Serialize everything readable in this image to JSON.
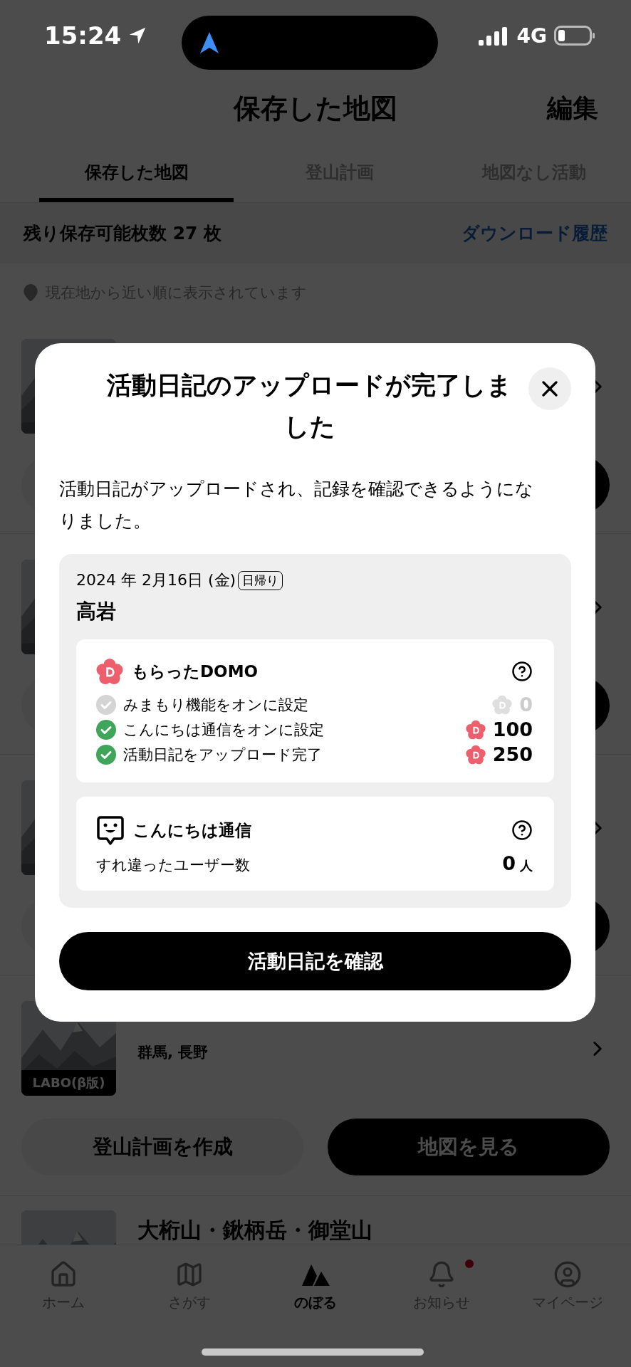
{
  "status_bar": {
    "time": "15:24",
    "network": "4G"
  },
  "header": {
    "title": "保存した地図",
    "edit": "編集"
  },
  "tabs": [
    {
      "label": "保存した地図",
      "selected": true
    },
    {
      "label": "登山計画",
      "selected": false
    },
    {
      "label": "地図なし活動",
      "selected": false
    }
  ],
  "quota": {
    "text": "残り保存可能枚数 27 枚",
    "link": "ダウンロード履歴"
  },
  "sort_note": "現在地から近い順に表示されています",
  "map_cards": [
    {
      "kind": "covered"
    },
    {
      "kind": "covered"
    },
    {
      "kind": "covered"
    },
    {
      "kind": "full",
      "region": "群馬, 長野",
      "badge": "LABO(β版)",
      "plan_button": "登山計画を作成",
      "map_button": "地図を見る"
    },
    {
      "kind": "partial",
      "title": "大桁山・鍬柄岳・御堂山"
    }
  ],
  "dialog": {
    "title": "活動日記のアップロードが完了しました",
    "message": "活動日記がアップロードされ、記録を確認できるようになりました。",
    "date": "2024 年 2月16日 (金)",
    "trip_type": "日帰り",
    "mountain": "高岩",
    "domo": {
      "title": "もらったDOMO",
      "rows": [
        {
          "label": "みまもり機能をオンに設定",
          "points": "0",
          "achieved": false
        },
        {
          "label": "こんにちは通信をオンに設定",
          "points": "100",
          "achieved": true
        },
        {
          "label": "活動日記をアップロード完了",
          "points": "250",
          "achieved": true
        }
      ]
    },
    "encounter": {
      "title": "こんにちは通信",
      "label": "すれ違ったユーザー数",
      "count": "0",
      "unit": "人"
    },
    "confirm_button": "活動日記を確認"
  },
  "nav": [
    {
      "kind": "home",
      "label": "ホーム",
      "selected": false,
      "badge": false
    },
    {
      "kind": "search",
      "label": "さがす",
      "selected": false,
      "badge": false
    },
    {
      "kind": "climb",
      "label": "のぼる",
      "selected": true,
      "badge": false
    },
    {
      "kind": "notice",
      "label": "お知らせ",
      "selected": false,
      "badge": true
    },
    {
      "kind": "mypage",
      "label": "マイページ",
      "selected": false,
      "badge": false
    }
  ]
}
